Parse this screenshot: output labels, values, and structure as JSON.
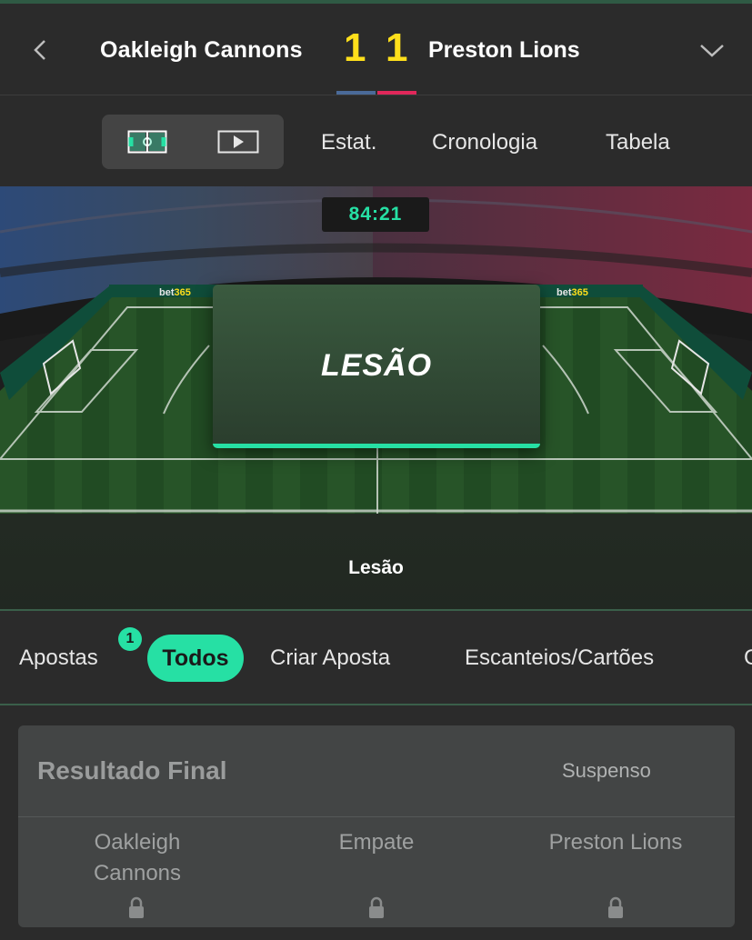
{
  "header": {
    "home_team": "Oakleigh Cannons",
    "away_team": "Preston Lions",
    "home_score": "1",
    "away_score": "1",
    "home_color": "#4a6a99",
    "away_color": "#e0275a",
    "score_color": "#ffdf1b"
  },
  "view_tabs": {
    "icons": [
      "pitch-icon",
      "video-icon"
    ],
    "items": [
      "Estat.",
      "Cronologia",
      "Tabela"
    ]
  },
  "match": {
    "clock": "84:21",
    "event_title": "LESÃO",
    "event_caption": "Lesão",
    "accent_color": "#26e0a4",
    "sponsor": "bet365"
  },
  "categories": {
    "bets_label": "Apostas",
    "bets_badge": "1",
    "active": "Todos",
    "items": [
      "Criar Aposta",
      "Escanteios/Cartões",
      "G"
    ]
  },
  "market": {
    "title": "Resultado Final",
    "status": "Suspenso",
    "outcomes": [
      {
        "line1": "Oakleigh",
        "line2": "Cannons",
        "locked": true
      },
      {
        "line1": "Empate",
        "line2": "",
        "locked": true
      },
      {
        "line1": "Preston Lions",
        "line2": "",
        "locked": true
      }
    ]
  }
}
